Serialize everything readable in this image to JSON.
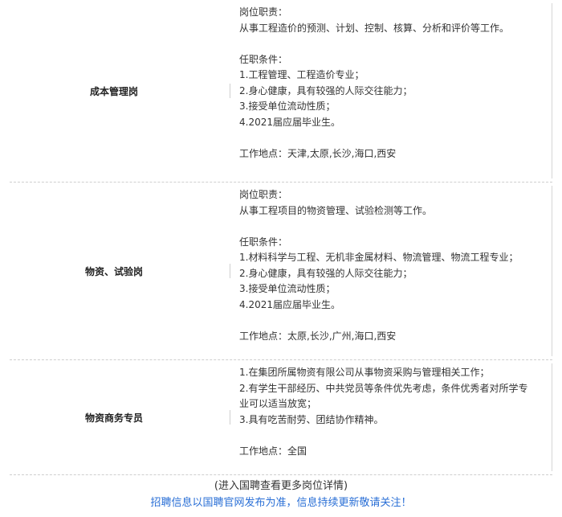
{
  "positions": [
    {
      "title": "成本管理岗",
      "duty_heading": "岗位职责：",
      "duty_lines": [
        "从事工程造价的预测、计划、控制、核算、分析和评价等工作。"
      ],
      "req_heading": "任职条件：",
      "req_lines": [
        "1.工程管理、工程造价专业；",
        "2.身心健康，具有较强的人际交往能力；",
        "3.接受单位流动性质；",
        "4.2021届应届毕业生。"
      ],
      "location": "工作地点：天津,太原,长沙,海口,西安"
    },
    {
      "title": "物资、试验岗",
      "duty_heading": "岗位职责：",
      "duty_lines": [
        "从事工程项目的物资管理、试验检测等工作。"
      ],
      "req_heading": "任职条件：",
      "req_lines": [
        "1.材料科学与工程、无机非金属材料、物流管理、物流工程专业；",
        "2.身心健康，具有较强的人际交往能力；",
        "3.接受单位流动性质；",
        "4.2021届应届毕业生。"
      ],
      "location": "工作地点：太原,长沙,广州,海口,西安"
    },
    {
      "title": "物资商务专员",
      "req_lines": [
        "1.在集团所属物资有限公司从事物资采购与管理相关工作；",
        "2.有学生干部经历、中共党员等条件优先考虑，条件优秀者对所学专",
        "业可以适当放宽；",
        "3.具有吃苦耐劳、团结协作精神。"
      ],
      "location": "工作地点：全国"
    }
  ],
  "footer": {
    "more": "(进入国聘查看更多岗位详情)",
    "notice": "招聘信息以国聘官网发布为准，信息持续更新敬请关注！"
  }
}
